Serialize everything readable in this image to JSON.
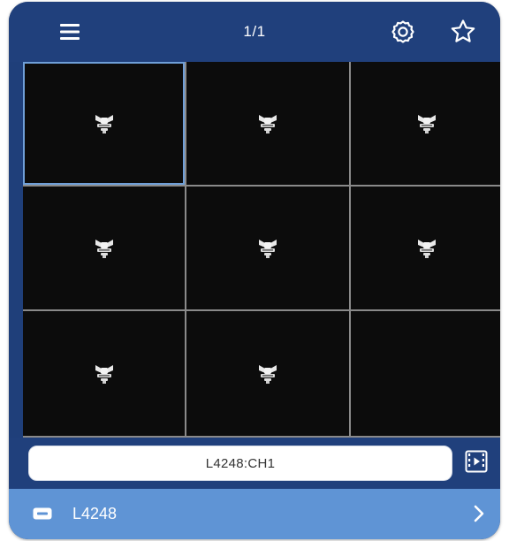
{
  "header": {
    "menu_icon": "hamburger-menu-icon",
    "page_indicator": "1/1",
    "settings_icon": "gear-icon",
    "favorite_icon": "star-outline-icon"
  },
  "grid": {
    "columns": 3,
    "rows": 3,
    "selected_cell": 1,
    "cells": [
      {
        "status": "camera-placeholder",
        "icon": "cctv-camera-icon"
      },
      {
        "status": "camera-placeholder",
        "icon": "cctv-camera-icon"
      },
      {
        "status": "camera-placeholder",
        "icon": "cctv-camera-icon"
      },
      {
        "status": "camera-placeholder",
        "icon": "cctv-camera-icon"
      },
      {
        "status": "camera-placeholder",
        "icon": "cctv-camera-icon"
      },
      {
        "status": "camera-placeholder",
        "icon": "cctv-camera-icon"
      },
      {
        "status": "camera-placeholder",
        "icon": "cctv-camera-icon"
      },
      {
        "status": "camera-placeholder",
        "icon": "cctv-camera-icon"
      },
      {
        "status": "empty"
      }
    ]
  },
  "channel": {
    "label": "L4248:CH1",
    "playback_icon": "video-playback-icon"
  },
  "device": {
    "icon": "dvr-device-icon",
    "name": "L4248",
    "chevron_icon": "chevron-right-icon"
  },
  "colors": {
    "header_bg": "#20407c",
    "grid_cell_bg": "#0c0c0c",
    "grid_line": "#8a8a8a",
    "selected_outline": "#6f9fd8",
    "device_row_bg": "#5f94d5",
    "icon": "#ffffff"
  }
}
